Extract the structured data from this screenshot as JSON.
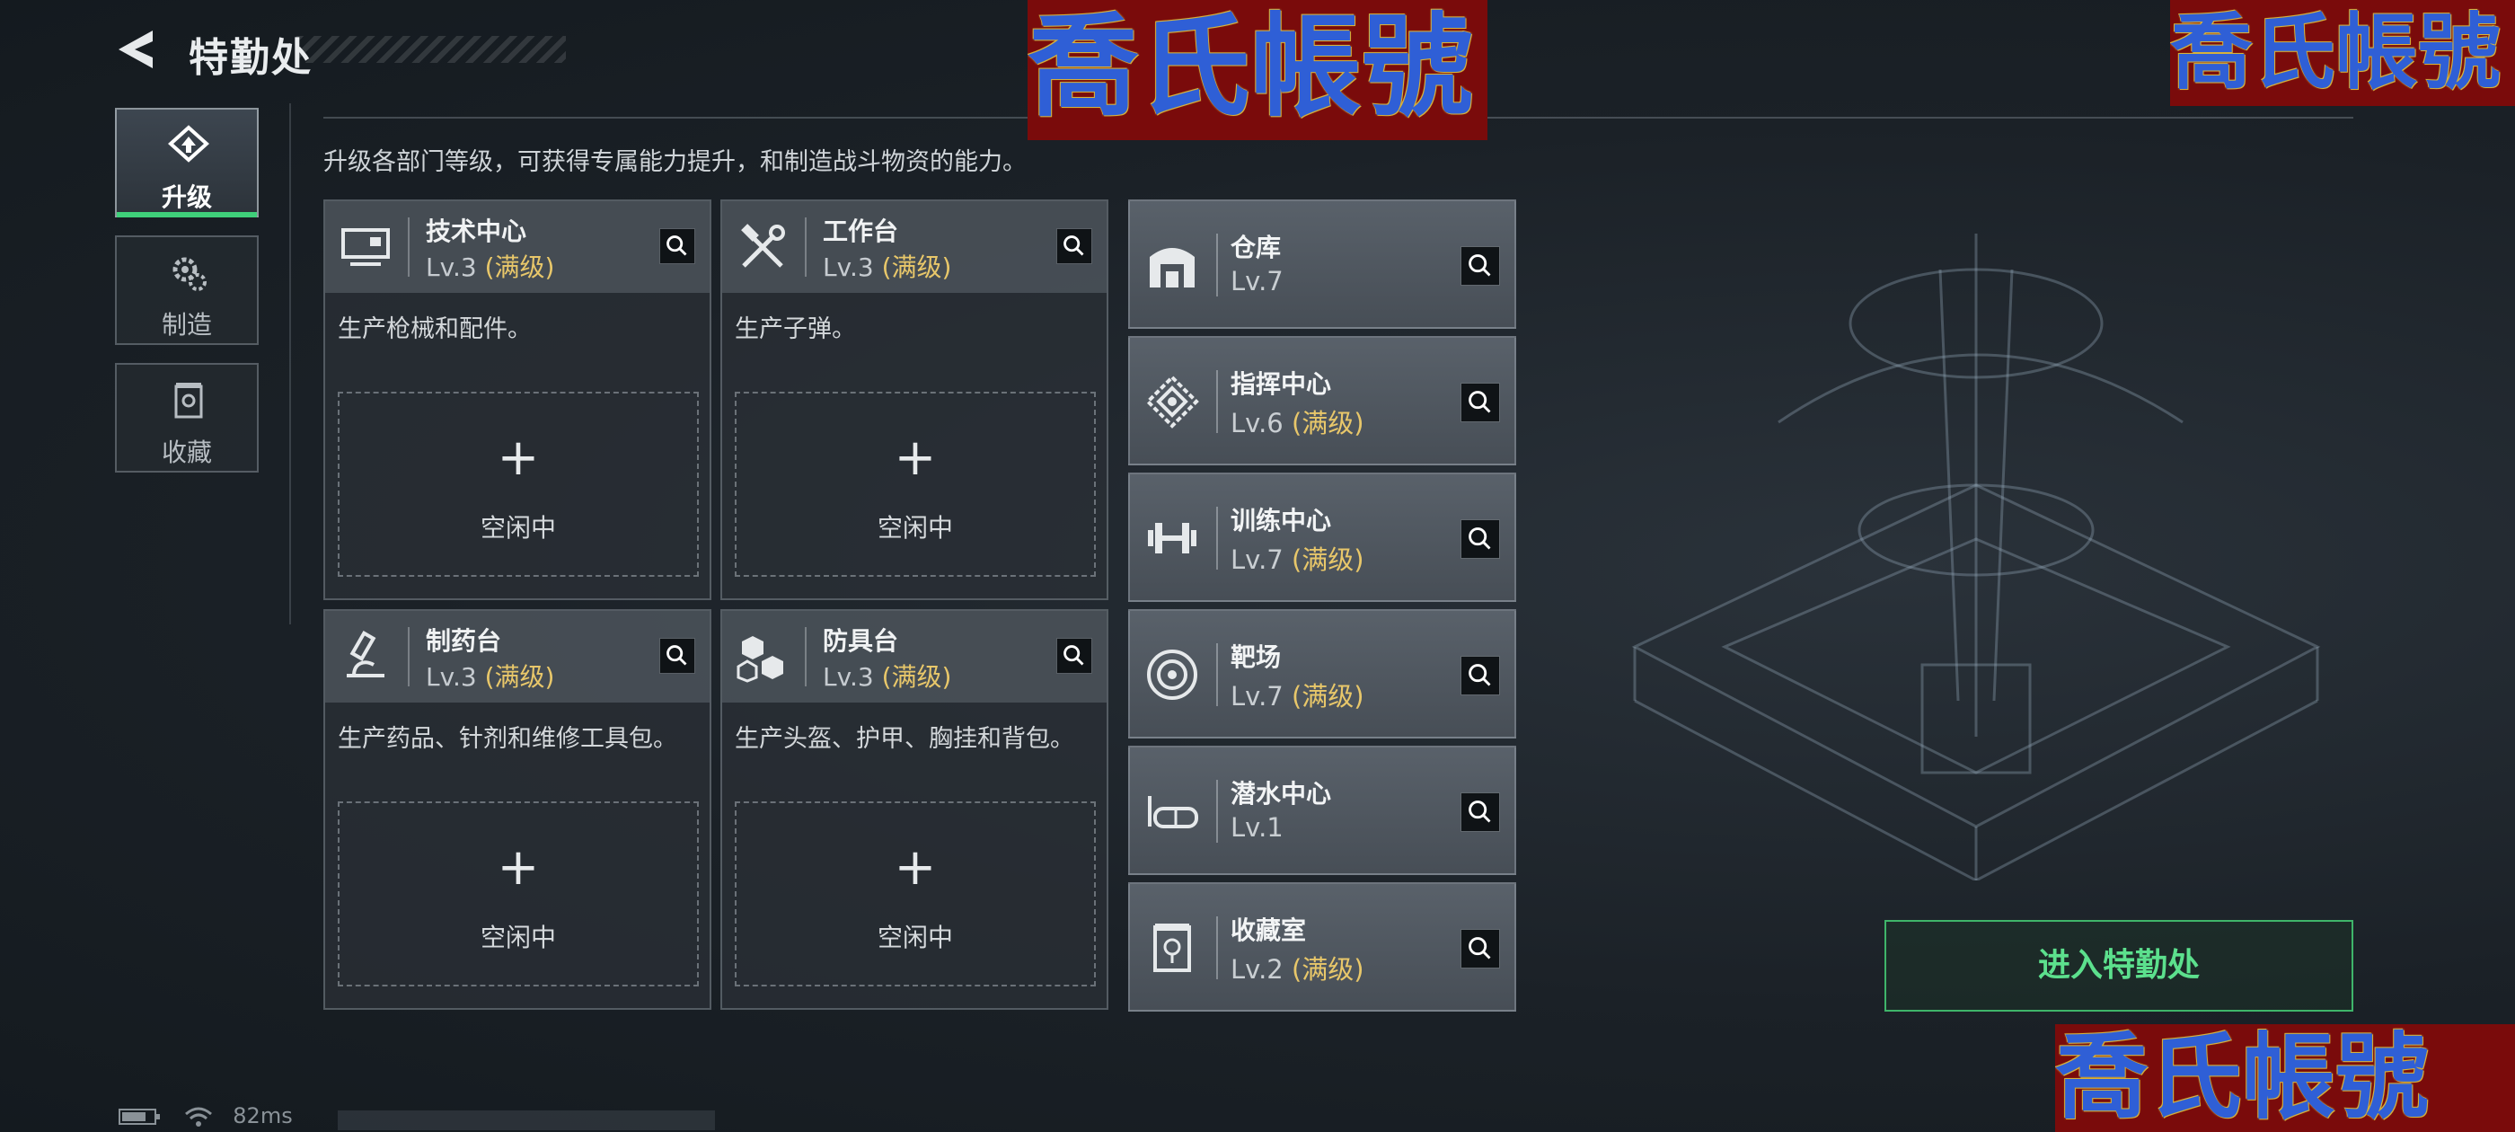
{
  "header": {
    "title": "特勤处"
  },
  "nav": [
    {
      "label": "升级",
      "icon": "upgrade-icon",
      "active": true
    },
    {
      "label": "制造",
      "icon": "gears-icon",
      "active": false
    },
    {
      "label": "收藏",
      "icon": "collection-icon",
      "active": false
    }
  ],
  "description": "升级各部门等级，可获得专属能力提升，和制造战斗物资的能力。",
  "workstations": [
    {
      "name": "技术中心",
      "level": "Lv.3",
      "max": "(满级)",
      "desc": "生产枪械和配件。",
      "slot": "空闲中",
      "icon": "tech-center-icon"
    },
    {
      "name": "工作台",
      "level": "Lv.3",
      "max": "(满级)",
      "desc": "生产子弹。",
      "slot": "空闲中",
      "icon": "workbench-icon"
    },
    {
      "name": "制药台",
      "level": "Lv.3",
      "max": "(满级)",
      "desc": "生产药品、针剂和维修工具包。",
      "slot": "空闲中",
      "icon": "pharmacy-icon"
    },
    {
      "name": "防具台",
      "level": "Lv.3",
      "max": "(满级)",
      "desc": "生产头盔、护甲、胸挂和背包。",
      "slot": "空闲中",
      "icon": "armor-bench-icon"
    }
  ],
  "facilities": [
    {
      "name": "仓库",
      "level": "Lv.7",
      "max": "",
      "icon": "warehouse-icon"
    },
    {
      "name": "指挥中心",
      "level": "Lv.6",
      "max": "(满级)",
      "icon": "command-center-icon"
    },
    {
      "name": "训练中心",
      "level": "Lv.7",
      "max": "(满级)",
      "icon": "dumbbell-icon"
    },
    {
      "name": "靶场",
      "level": "Lv.7",
      "max": "(满级)",
      "icon": "target-icon"
    },
    {
      "name": "潜水中心",
      "level": "Lv.1",
      "max": "",
      "icon": "diving-mask-icon"
    },
    {
      "name": "收藏室",
      "level": "Lv.2",
      "max": "(满级)",
      "icon": "collection-room-icon"
    }
  ],
  "enter_button": "进入特勤处",
  "watermark": "喬氏帳號",
  "status": {
    "ping": "82ms"
  },
  "colors": {
    "accent_green": "#3fd07a",
    "max_level": "#e8c76a",
    "watermark_bg": "#7a0b0b",
    "watermark_text": "#2f5fd6"
  }
}
